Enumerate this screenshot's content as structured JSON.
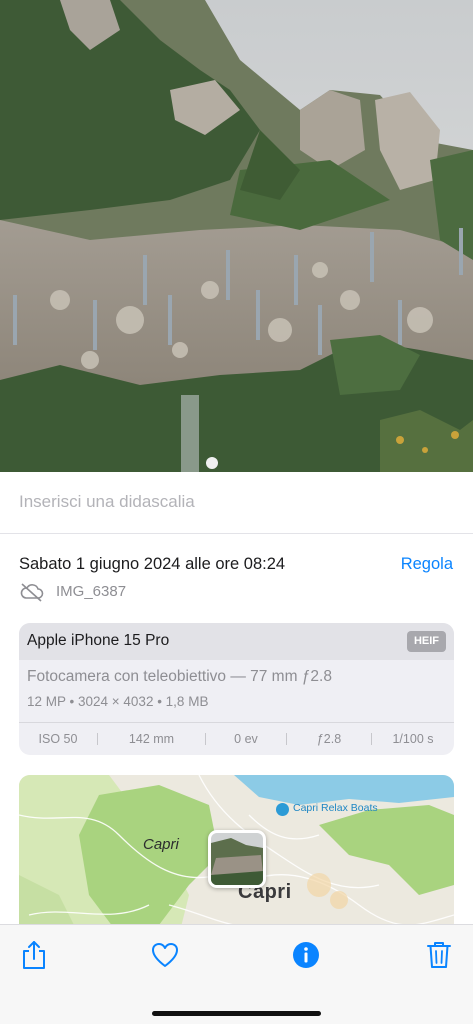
{
  "caption": {
    "placeholder": "Inserisci una didascalia"
  },
  "info": {
    "date": "Sabato 1 giugno 2024 alle ore 08:24",
    "adjust_label": "Regola",
    "cloud_icon": "cloud-slash-icon",
    "filename": "IMG_6387"
  },
  "exif": {
    "device": "Apple iPhone 15 Pro",
    "format": "HEIF",
    "lens": "Fotocamera con teleobiettivo — 77 mm ƒ2.8",
    "specs": "12 MP  •  3024 × 4032  •  1,8 MB",
    "iso": "ISO 50",
    "focal_length": "142 mm",
    "exposure": "0 ev",
    "aperture": "ƒ2.8",
    "shutter": "1/100 s"
  },
  "map": {
    "area_label": "Capri",
    "city_label": "Capri",
    "poi_label": "Capri Relax Boats"
  },
  "toolbar": {
    "share_icon": "share-icon",
    "favorite_icon": "heart-icon",
    "info_icon": "info-icon",
    "delete_icon": "trash-icon",
    "accent_color": "#0a84ff"
  }
}
